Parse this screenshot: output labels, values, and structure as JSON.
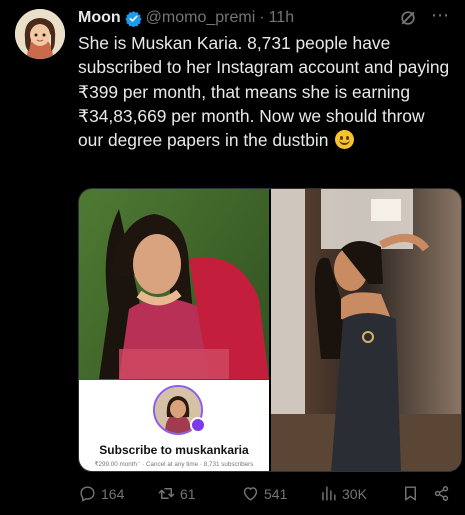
{
  "tweet": {
    "name": "Moon",
    "handle": "@momo_premi",
    "separator": "·",
    "time": "11h",
    "text": "She is Muskan Karia. 8,731 people have subscribed to her Instagram account and paying ₹399 per month, that means she is earning ₹34,83,669 per month. Now we should throw our degree papers in the dustbin",
    "emoji": "slightly-smiling-face"
  },
  "media": {
    "subscribe_title": "Subscribe to muskankaria",
    "subscribe_meta": "₹299.00 month⁻ · Cancel at any time · 8,731 subscribers"
  },
  "actions": {
    "replies": "164",
    "reposts": "61",
    "likes": "541",
    "views": "30K"
  },
  "colors": {
    "background": "#000000",
    "text": "#e7e9ea",
    "muted": "#71767b",
    "verified": "#1d9bf0"
  }
}
